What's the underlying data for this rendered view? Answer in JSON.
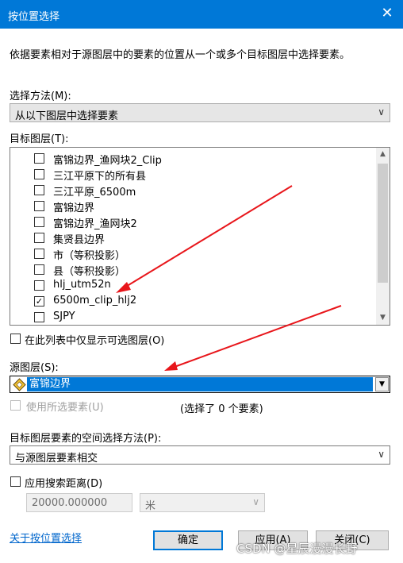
{
  "window": {
    "title": "按位置选择",
    "close_glyph": "✕"
  },
  "description": "依据要素相对于源图层中的要素的位置从一个或多个目标图层中选择要素。",
  "selection_method": {
    "label": "选择方法(M):",
    "value": "从以下图层中选择要素"
  },
  "target_layers": {
    "label": "目标图层(T):",
    "items": [
      {
        "label": "富锦边界_渔网块2_Clip",
        "checked": false
      },
      {
        "label": "三江平原下的所有县",
        "checked": false
      },
      {
        "label": "三江平原_6500m",
        "checked": false
      },
      {
        "label": "富锦边界",
        "checked": false
      },
      {
        "label": "富锦边界_渔网块2",
        "checked": false
      },
      {
        "label": "集贤县边界",
        "checked": false
      },
      {
        "label": "市（等积投影）",
        "checked": false
      },
      {
        "label": "县（等积投影）",
        "checked": false
      },
      {
        "label": "hlj_utm52n",
        "checked": false
      },
      {
        "label": "6500m_clip_hlj2",
        "checked": true
      },
      {
        "label": "SJPY",
        "checked": false
      }
    ],
    "check_glyph": "✓"
  },
  "only_selectable": {
    "label": "在此列表中仅显示可选图层(O)",
    "checked": false
  },
  "source_layer": {
    "label": "源图层(S):",
    "value": "富锦边界"
  },
  "use_selected": {
    "label": "使用所选要素(U)",
    "checked": false,
    "disabled": true
  },
  "selected_count_text": "(选择了 0 个要素)",
  "spatial_method": {
    "label": "目标图层要素的空间选择方法(P):",
    "value": "与源图层要素相交"
  },
  "search_distance": {
    "label": "应用搜索距离(D)",
    "checked": false,
    "value": "20000.000000",
    "unit": "米"
  },
  "footer": {
    "help_link": "关于按位置选择",
    "ok": "确定",
    "apply": "应用(A)",
    "close": "关闭(C)"
  },
  "watermark": "CSDN @星辰漫漫长野",
  "colors": {
    "title_bar": "#0078d7",
    "annotation_arrow": "#e8161b",
    "selection": "#0078d7"
  }
}
